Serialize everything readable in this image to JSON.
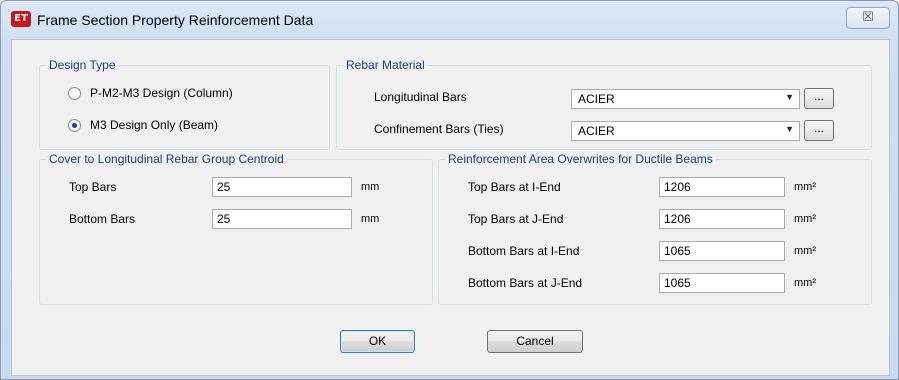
{
  "window": {
    "icon_text": "ET",
    "title": "Frame Section Property Reinforcement Data",
    "close_glyph": "☒"
  },
  "design_type": {
    "legend": "Design Type",
    "options": [
      {
        "label": "P-M2-M3 Design  (Column)",
        "selected": false
      },
      {
        "label": "M3 Design Only  (Beam)",
        "selected": true
      }
    ]
  },
  "rebar_material": {
    "legend": "Rebar Material",
    "longitudinal": {
      "label": "Longitudinal Bars",
      "value": "ACIER"
    },
    "confinement": {
      "label": "Confinement Bars (Ties)",
      "value": "ACIER"
    },
    "browse_label": "...",
    "dropdown_glyph": "▼"
  },
  "cover": {
    "legend": "Cover to Longitudinal Rebar Group Centroid",
    "rows": [
      {
        "label": "Top Bars",
        "value": "25",
        "unit": "mm"
      },
      {
        "label": "Bottom  Bars",
        "value": "25",
        "unit": "mm"
      }
    ]
  },
  "overwrites": {
    "legend": "Reinforcement Area Overwrites for Ductile Beams",
    "rows": [
      {
        "label": "Top Bars at I-End",
        "value": "1206",
        "unit": "mm²"
      },
      {
        "label": "Top Bars at J-End",
        "value": "1206",
        "unit": "mm²"
      },
      {
        "label": "Bottom Bars at I-End",
        "value": "1065",
        "unit": "mm²"
      },
      {
        "label": "Bottom Bars at J-End",
        "value": "1065",
        "unit": "mm²"
      }
    ]
  },
  "buttons": {
    "ok": "OK",
    "cancel": "Cancel"
  }
}
